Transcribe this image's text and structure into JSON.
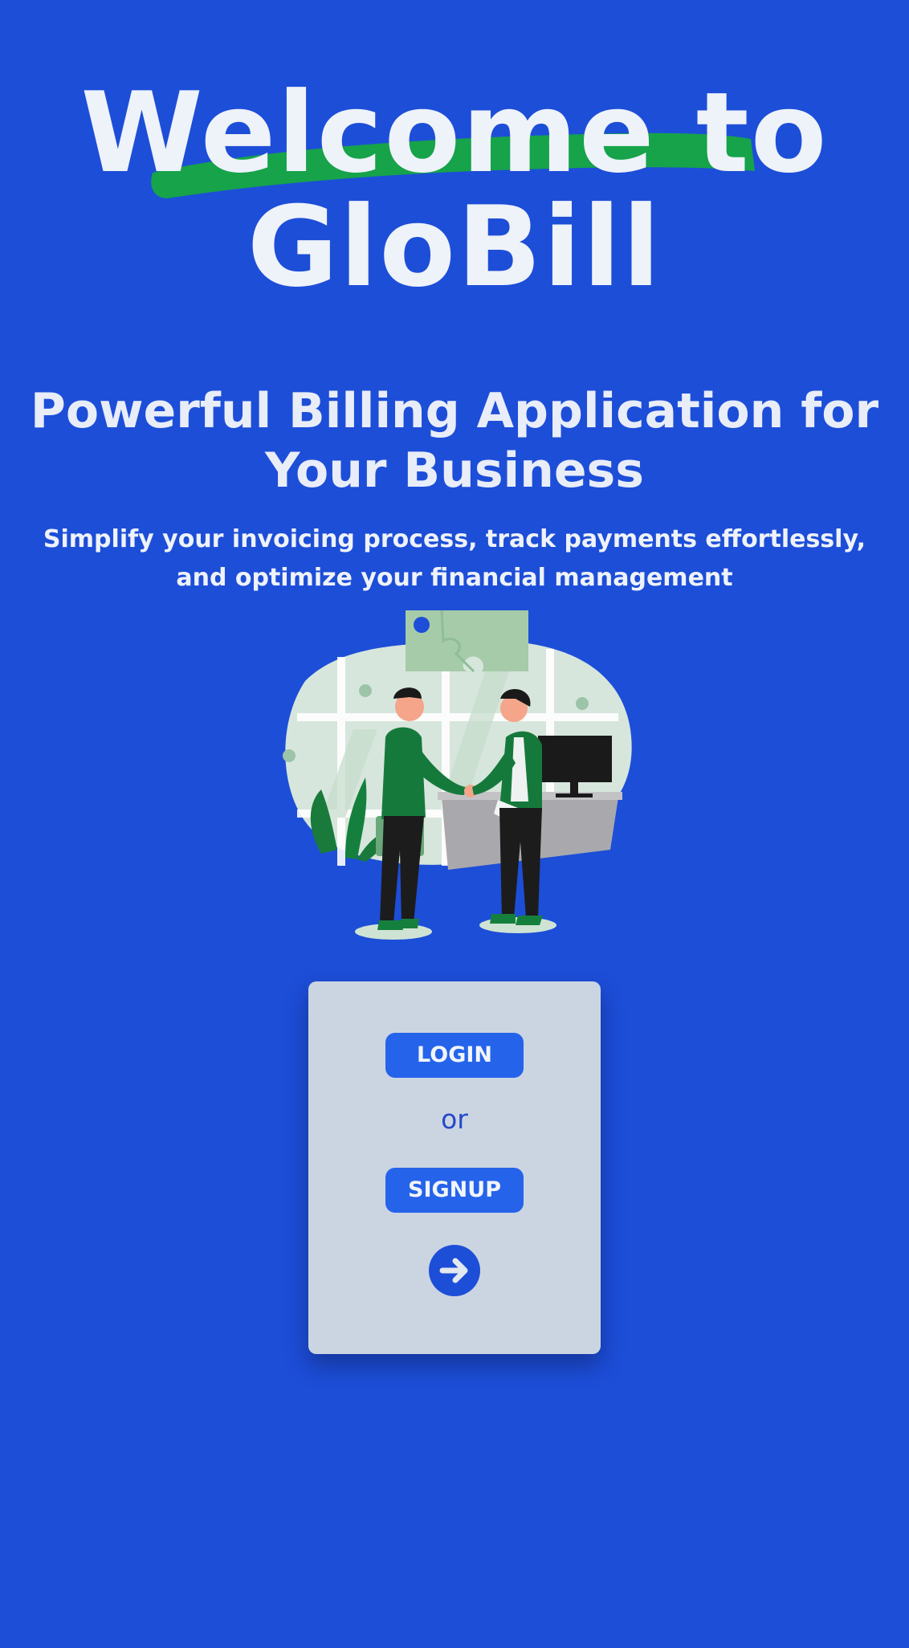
{
  "hero": {
    "title_line1": "Welcome to",
    "title_line2": "GloBill"
  },
  "subtitle": "Powerful Billing Application for Your Business",
  "tagline": "Simplify your invoicing process, track payments effortlessly, and optimize your financial management",
  "illustration": {
    "icon": "business-handshake-illustration"
  },
  "auth_card": {
    "login_label": "LOGIN",
    "or_label": "or",
    "signup_label": "SIGNUP",
    "proceed_icon": "arrow-right-icon"
  },
  "colors": {
    "background": "#1d4ed8",
    "button": "#2563eb",
    "card": "#cbd5e1",
    "brush_accent": "#16a34a",
    "heading_text": "#eef2f9"
  }
}
